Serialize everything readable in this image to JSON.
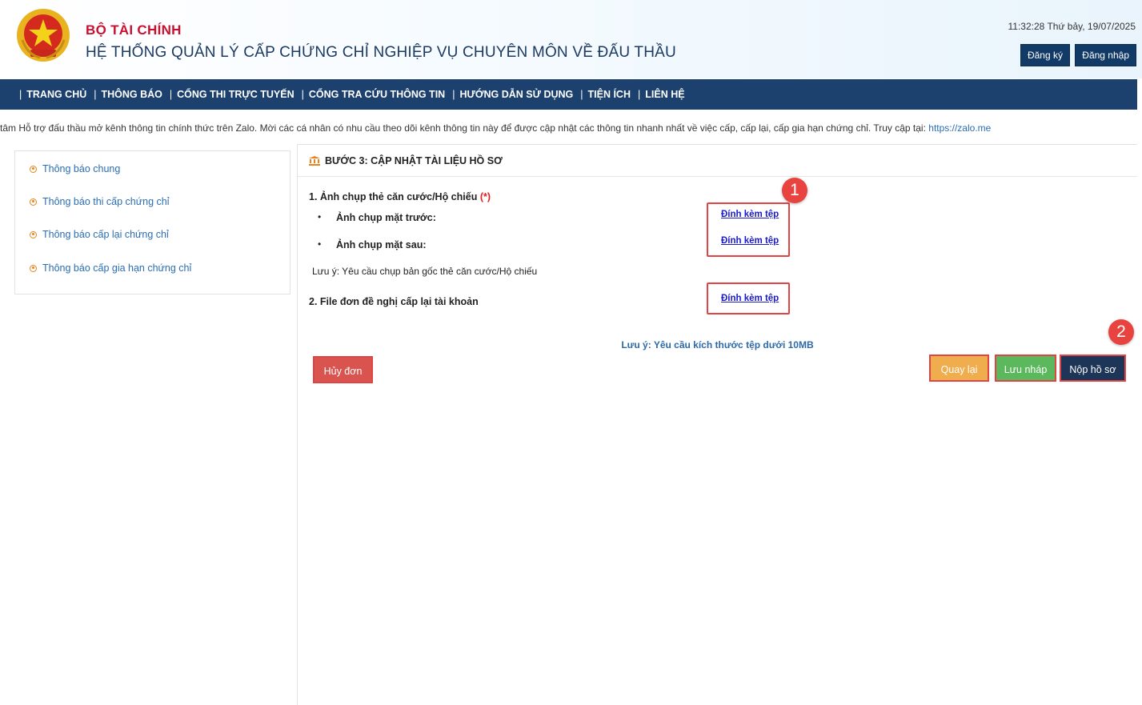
{
  "header": {
    "ministry": "BỘ TÀI CHÍNH",
    "system_title": "HỆ THỐNG QUẢN LÝ CẤP CHỨNG CHỈ NGHIỆP VỤ CHUYÊN MÔN VỀ ĐẤU THẦU",
    "clock": "11:32:28 Thứ bảy, 19/07/2025",
    "register_label": "Đăng ký",
    "login_label": "Đăng nhập"
  },
  "nav": {
    "items": [
      "TRANG CHỦ",
      "THÔNG BÁO",
      "CỔNG THI TRỰC TUYẾN",
      "CỔNG TRA CỨU THÔNG TIN",
      "HƯỚNG DẪN SỬ DỤNG",
      "TIỆN ÍCH",
      "LIÊN HỆ"
    ],
    "separator": "|"
  },
  "marquee": {
    "text": "tâm Hỗ trợ đấu thầu mở kênh thông tin chính thức trên Zalo. Mời các cá nhân có nhu cầu theo dõi kênh thông tin này để được cập nhật các thông tin nhanh nhất về việc cấp, cấp lại, cấp gia hạn chứng chỉ. Truy cập tại: ",
    "link": "https://zalo.me"
  },
  "sidebar": {
    "items": [
      "Thông báo chung",
      "Thông báo thi cấp chứng chỉ",
      "Thông báo cấp lại chứng chỉ",
      "Thông báo cấp gia hạn chứng chỉ"
    ]
  },
  "main": {
    "step_title": "BƯỚC 3: CẬP NHẬT TÀI LIỆU HỒ SƠ",
    "section1_label": "1. Ảnh chụp thẻ căn cước/Hộ chiếu",
    "required_mark": "(*)",
    "bullet_char": "•",
    "front_label": "Ảnh chụp mặt trước:",
    "back_label": "Ảnh chụp mặt sau:",
    "id_note": "Lưu ý: Yêu cầu chụp bản gốc thẻ căn cước/Hộ chiếu",
    "section2_label": "2. File đơn đề nghị cấp lại tài khoản",
    "attach_label": "Đính kèm tệp",
    "size_note": "Lưu ý: Yêu cầu kích thước tệp dưới 10MB",
    "cancel_label": "Hủy đơn",
    "back_button_label": "Quay lại",
    "draft_label": "Lưu nháp",
    "submit_label": "Nộp hồ sơ"
  },
  "annotations": {
    "badge1": "1",
    "badge2": "2"
  },
  "colors": {
    "nav_bg": "#1d416e",
    "ministry_red": "#c8102e",
    "cancel_btn": "#d9534f",
    "back_btn": "#f0ad4e",
    "draft_btn": "#5cb85c",
    "submit_btn": "#1d3557",
    "annotation_red": "#e8433f"
  }
}
